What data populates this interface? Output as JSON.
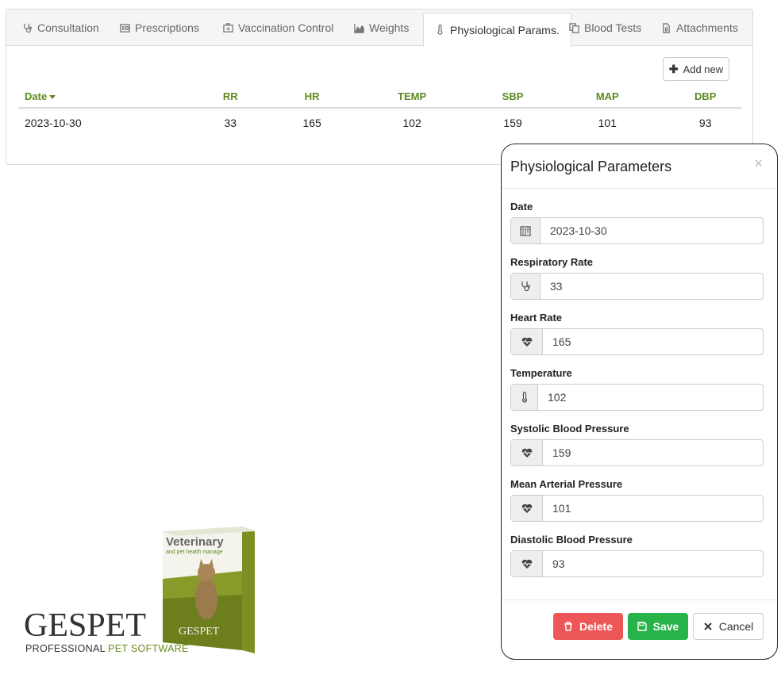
{
  "tabs": [
    {
      "label": "Consultation",
      "icon": "stethoscope-icon"
    },
    {
      "label": "Prescriptions",
      "icon": "prescription-icon"
    },
    {
      "label": "Vaccination Control",
      "icon": "medical-kit-icon"
    },
    {
      "label": "Weights",
      "icon": "area-chart-icon"
    },
    {
      "label": "Physiological Params.",
      "icon": "thermometer-icon",
      "active": true
    },
    {
      "label": "Blood Tests",
      "icon": "copy-icon"
    },
    {
      "label": "Attachments",
      "icon": "file-icon"
    }
  ],
  "toolbar": {
    "add_new_label": "Add new"
  },
  "table": {
    "columns": [
      "Date",
      "RR",
      "HR",
      "TEMP",
      "SBP",
      "MAP",
      "DBP"
    ],
    "rows": [
      {
        "date": "2023-10-30",
        "rr": "33",
        "hr": "165",
        "temp": "102",
        "sbp": "159",
        "map": "101",
        "dbp": "93"
      }
    ]
  },
  "branding": {
    "name_part1": "GES",
    "name_part2": "PET",
    "tagline_part1": "PROFESSIONAL ",
    "tagline_part2": "PET SOFTWARE",
    "box_title": "Veterinary",
    "box_subtitle": "and pet health manage",
    "box_logo": "GESPET"
  },
  "modal": {
    "title": "Physiological Parameters",
    "close_label": "×",
    "fields": [
      {
        "label": "Date",
        "value": "2023-10-30",
        "icon": "calendar-icon"
      },
      {
        "label": "Respiratory Rate",
        "value": "33",
        "icon": "stethoscope-icon"
      },
      {
        "label": "Heart Rate",
        "value": "165",
        "icon": "heartbeat-icon"
      },
      {
        "label": "Temperature",
        "value": "102",
        "icon": "thermometer-icon"
      },
      {
        "label": "Systolic Blood Pressure",
        "value": "159",
        "icon": "heartbeat-icon"
      },
      {
        "label": "Mean Arterial Pressure",
        "value": "101",
        "icon": "heartbeat-icon"
      },
      {
        "label": "Diastolic Blood Pressure",
        "value": "93",
        "icon": "heartbeat-icon"
      }
    ],
    "buttons": {
      "delete": "Delete",
      "save": "Save",
      "cancel": "Cancel"
    }
  },
  "colors": {
    "accent_green": "#5f8a1e",
    "delete": "#ee5757",
    "save": "#28b34a"
  }
}
